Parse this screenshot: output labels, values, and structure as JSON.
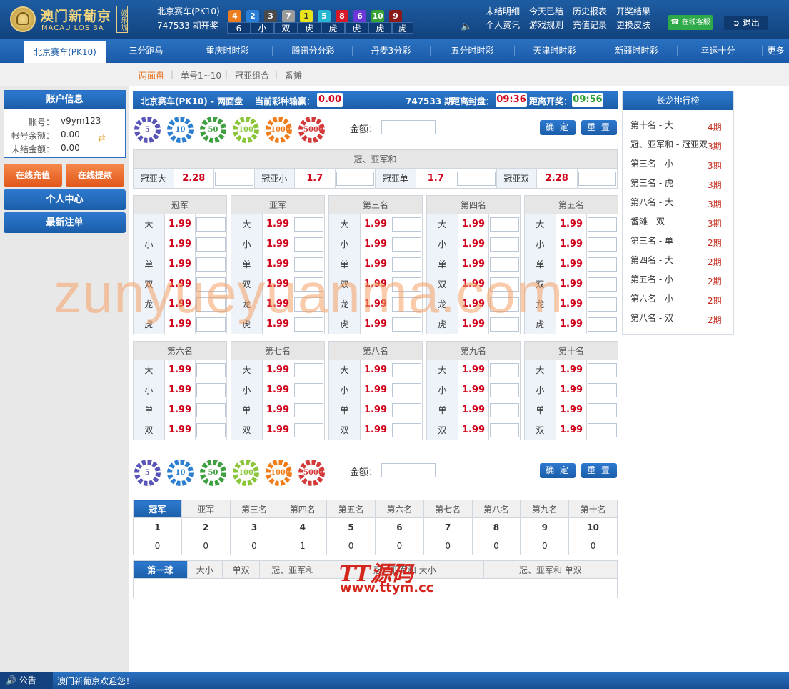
{
  "logo": {
    "cn": "澳门新葡京",
    "en": "MACAU LOSIBA",
    "tag": "娱乐城"
  },
  "header": {
    "game": "北京赛车(PK10)",
    "period": "747533 期开奖",
    "balls": [
      {
        "n": "4",
        "c": "#ee7d1d"
      },
      {
        "n": "2",
        "c": "#2a80d9"
      },
      {
        "n": "3",
        "c": "#4a4a4a"
      },
      {
        "n": "7",
        "c": "#9b9b9b"
      },
      {
        "n": "1",
        "c": "#e8e41b"
      },
      {
        "n": "5",
        "c": "#28b7d2"
      },
      {
        "n": "8",
        "c": "#d8192a"
      },
      {
        "n": "6",
        "c": "#6b37d6"
      },
      {
        "n": "10",
        "c": "#36a332"
      },
      {
        "n": "9",
        "c": "#8b1a1a"
      }
    ],
    "results": [
      "6",
      "小",
      "双",
      "虎",
      "虎",
      "虎",
      "虎",
      "虎"
    ],
    "links": [
      "未结明细",
      "今天已结",
      "历史报表",
      "开奖结果",
      "个人资讯",
      "游戏规则",
      "充值记录",
      "更换皮肤"
    ],
    "cs_label": "在线客服",
    "logout_label": "退出"
  },
  "nav": [
    "北京赛车(PK10)",
    "三分跑马",
    "重庆时时彩",
    "腾讯分分彩",
    "丹麦3分彩",
    "五分时时彩",
    "天津时时彩",
    "新疆时时彩",
    "幸运十分",
    "更多"
  ],
  "subnav": [
    "两面盘",
    "单号1~10",
    "冠亚组合",
    "番摊"
  ],
  "account": {
    "title": "账户信息",
    "rows": [
      {
        "k": "账号：",
        "v": "v9ym123"
      },
      {
        "k": "帐号余额：",
        "v": "0.00"
      },
      {
        "k": "未结金额：",
        "v": "0.00"
      }
    ],
    "recharge": "在线充值",
    "withdraw": "在线提款",
    "center": "个人中心",
    "latest": "最新注单"
  },
  "info": {
    "title": "北京赛车(PK10) - 两面盘",
    "winlose_label": "当前彩种输赢：",
    "winlose": "0.00",
    "period": "747533 期",
    "close_label": "距离封盘：",
    "close": "09:36",
    "open_label": "距离开奖：",
    "open": "09:56"
  },
  "chips": [
    {
      "v": "5",
      "c": "#5a56b8"
    },
    {
      "v": "10",
      "c": "#2d7fd0"
    },
    {
      "v": "50",
      "c": "#3fa042"
    },
    {
      "v": "100",
      "c": "#8ac53a"
    },
    {
      "v": "1000",
      "c": "#f07d1a"
    },
    {
      "v": "5000",
      "c": "#d43a3a"
    }
  ],
  "amount_label": "金额：",
  "confirm": "确 定",
  "reset": "重 置",
  "sum": {
    "title": "冠、亚军和",
    "items": [
      {
        "k": "冠亚大",
        "o": "2.28"
      },
      {
        "k": "冠亚小",
        "o": "1.7"
      },
      {
        "k": "冠亚单",
        "o": "1.7"
      },
      {
        "k": "冠亚双",
        "o": "2.28"
      }
    ]
  },
  "rank_top": [
    {
      "t": "冠军",
      "r": [
        [
          "大",
          "1.99"
        ],
        [
          "小",
          "1.99"
        ],
        [
          "单",
          "1.99"
        ],
        [
          "双",
          "1.99"
        ],
        [
          "龙",
          "1.99"
        ],
        [
          "虎",
          "1.99"
        ]
      ]
    },
    {
      "t": "亚军",
      "r": [
        [
          "大",
          "1.99"
        ],
        [
          "小",
          "1.99"
        ],
        [
          "单",
          "1.99"
        ],
        [
          "双",
          "1.99"
        ],
        [
          "龙",
          "1.99"
        ],
        [
          "虎",
          "1.99"
        ]
      ]
    },
    {
      "t": "第三名",
      "r": [
        [
          "大",
          "1.99"
        ],
        [
          "小",
          "1.99"
        ],
        [
          "单",
          "1.99"
        ],
        [
          "双",
          "1.99"
        ],
        [
          "龙",
          "1.99"
        ],
        [
          "虎",
          "1.99"
        ]
      ]
    },
    {
      "t": "第四名",
      "r": [
        [
          "大",
          "1.99"
        ],
        [
          "小",
          "1.99"
        ],
        [
          "单",
          "1.99"
        ],
        [
          "双",
          "1.99"
        ],
        [
          "龙",
          "1.99"
        ],
        [
          "虎",
          "1.99"
        ]
      ]
    },
    {
      "t": "第五名",
      "r": [
        [
          "大",
          "1.99"
        ],
        [
          "小",
          "1.99"
        ],
        [
          "单",
          "1.99"
        ],
        [
          "双",
          "1.99"
        ],
        [
          "龙",
          "1.99"
        ],
        [
          "虎",
          "1.99"
        ]
      ]
    }
  ],
  "rank_bottom": [
    {
      "t": "第六名",
      "r": [
        [
          "大",
          "1.99"
        ],
        [
          "小",
          "1.99"
        ],
        [
          "单",
          "1.99"
        ],
        [
          "双",
          "1.99"
        ]
      ]
    },
    {
      "t": "第七名",
      "r": [
        [
          "大",
          "1.99"
        ],
        [
          "小",
          "1.99"
        ],
        [
          "单",
          "1.99"
        ],
        [
          "双",
          "1.99"
        ]
      ]
    },
    {
      "t": "第八名",
      "r": [
        [
          "大",
          "1.99"
        ],
        [
          "小",
          "1.99"
        ],
        [
          "单",
          "1.99"
        ],
        [
          "双",
          "1.99"
        ]
      ]
    },
    {
      "t": "第九名",
      "r": [
        [
          "大",
          "1.99"
        ],
        [
          "小",
          "1.99"
        ],
        [
          "单",
          "1.99"
        ],
        [
          "双",
          "1.99"
        ]
      ]
    },
    {
      "t": "第十名",
      "r": [
        [
          "大",
          "1.99"
        ],
        [
          "小",
          "1.99"
        ],
        [
          "单",
          "1.99"
        ],
        [
          "双",
          "1.99"
        ]
      ]
    }
  ],
  "stats": {
    "tabs": [
      "冠军",
      "亚军",
      "第三名",
      "第四名",
      "第五名",
      "第六名",
      "第七名",
      "第八名",
      "第九名",
      "第十名"
    ],
    "nums": [
      "1",
      "2",
      "3",
      "4",
      "5",
      "6",
      "7",
      "8",
      "9",
      "10"
    ],
    "counts": [
      "0",
      "0",
      "0",
      "1",
      "0",
      "0",
      "0",
      "0",
      "0",
      "0"
    ],
    "tabs2": [
      "第一球",
      "大小",
      "单双",
      "冠、亚军和",
      "冠、亚军和 大小",
      "冠、亚军和 单双"
    ]
  },
  "longrank": {
    "title": "长龙排行榜",
    "items": [
      {
        "k": "第十名 - 大",
        "c": "4期"
      },
      {
        "k": "冠、亚军和 - 冠亚双",
        "c": "3期"
      },
      {
        "k": "第三名 - 小",
        "c": "3期"
      },
      {
        "k": "第三名 - 虎",
        "c": "3期"
      },
      {
        "k": "第八名 - 大",
        "c": "3期"
      },
      {
        "k": "番滩 - 双",
        "c": "3期"
      },
      {
        "k": "第三名 - 单",
        "c": "2期"
      },
      {
        "k": "第四名 - 大",
        "c": "2期"
      },
      {
        "k": "第五名 - 小",
        "c": "2期"
      },
      {
        "k": "第六名 - 小",
        "c": "2期"
      },
      {
        "k": "第八名 - 双",
        "c": "2期"
      }
    ]
  },
  "watermark": "zunyueyuanma.com",
  "ttlogo": {
    "a": "TT源码",
    "b": "www.ttym.cc"
  },
  "footer": {
    "label": "公告",
    "msg": "澳门新葡京欢迎您！"
  }
}
